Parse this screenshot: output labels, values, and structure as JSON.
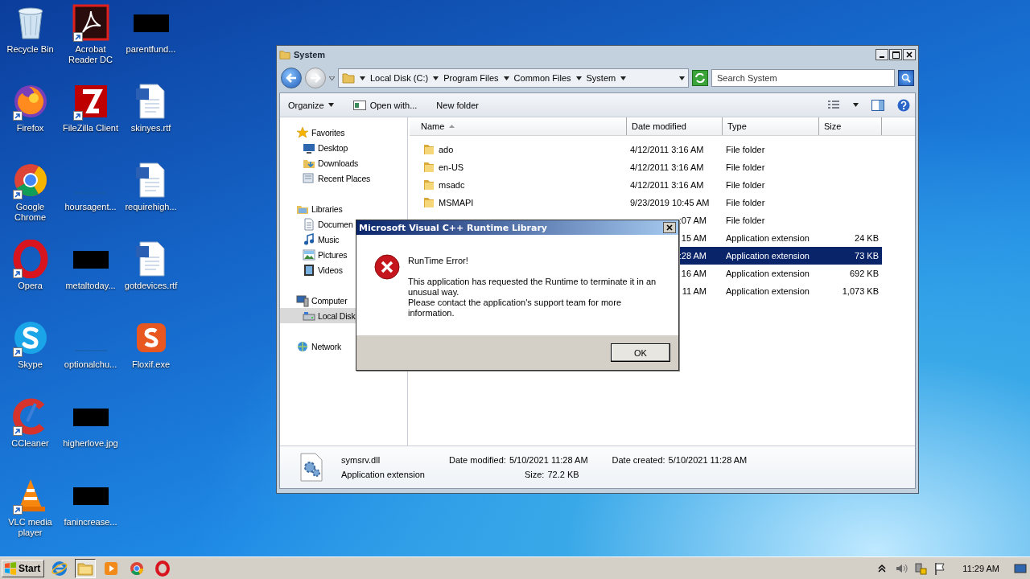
{
  "desktop_icons": [
    {
      "label": "Recycle Bin",
      "kind": "recycle",
      "shortcut": false
    },
    {
      "label": "Firefox",
      "kind": "firefox",
      "shortcut": true
    },
    {
      "label": "Google Chrome",
      "kind": "chrome",
      "shortcut": true
    },
    {
      "label": "Opera",
      "kind": "opera",
      "shortcut": true
    },
    {
      "label": "Skype",
      "kind": "skype",
      "shortcut": true
    },
    {
      "label": "CCleaner",
      "kind": "ccleaner",
      "shortcut": true
    },
    {
      "label": "VLC media player",
      "kind": "vlc",
      "shortcut": true
    },
    {
      "label": "Acrobat Reader DC",
      "kind": "acrobat",
      "shortcut": true
    },
    {
      "label": "FileZilla Client",
      "kind": "filezilla",
      "shortcut": true
    },
    {
      "label": "hoursagent...",
      "kind": "blank",
      "shortcut": false
    },
    {
      "label": "metaltoday...",
      "kind": "dark",
      "shortcut": false
    },
    {
      "label": "optionalchu...",
      "kind": "blank",
      "shortcut": false
    },
    {
      "label": "higherlove.jpg",
      "kind": "dark",
      "shortcut": false
    },
    {
      "label": "fanincrease...",
      "kind": "dark",
      "shortcut": false
    },
    {
      "label": "parentfund...",
      "kind": "dark",
      "shortcut": false
    },
    {
      "label": "skinyes.rtf",
      "kind": "word",
      "shortcut": false
    },
    {
      "label": "requirehigh...",
      "kind": "word",
      "shortcut": false
    },
    {
      "label": "gotdevices.rtf",
      "kind": "word",
      "shortcut": false
    },
    {
      "label": "Floxif.exe",
      "kind": "floxif",
      "shortcut": false
    }
  ],
  "explorer": {
    "title": "System",
    "breadcrumb": [
      "Local Disk (C:)",
      "Program Files",
      "Common Files",
      "System"
    ],
    "search": {
      "placeholder": "Search System"
    },
    "toolbar": {
      "organize": "Organize",
      "open_with": "Open with...",
      "new_folder": "New folder"
    },
    "nav": [
      {
        "label": "Favorites",
        "kind": "star",
        "selected": false,
        "children": [
          {
            "label": "Desktop",
            "kind": "desktop",
            "selected": false
          },
          {
            "label": "Downloads",
            "kind": "downloads",
            "selected": false
          },
          {
            "label": "Recent Places",
            "kind": "recent",
            "selected": false
          }
        ]
      },
      {
        "label": "Libraries",
        "kind": "libraries",
        "selected": false,
        "children": [
          {
            "label": "Documen",
            "kind": "documents",
            "selected": false
          },
          {
            "label": "Music",
            "kind": "music",
            "selected": false
          },
          {
            "label": "Pictures",
            "kind": "pictures",
            "selected": false
          },
          {
            "label": "Videos",
            "kind": "videos",
            "selected": false
          }
        ]
      },
      {
        "label": "Computer",
        "kind": "computer",
        "selected": false,
        "children": [
          {
            "label": "Local Disk",
            "kind": "disk",
            "selected": true
          }
        ]
      },
      {
        "label": "Network",
        "kind": "network",
        "selected": false
      }
    ],
    "columns": [
      {
        "label": "Name",
        "sorted": true
      },
      {
        "label": "Date modified",
        "sorted": false
      },
      {
        "label": "Type",
        "sorted": false
      },
      {
        "label": "Size",
        "sorted": false
      }
    ],
    "files": [
      {
        "kind": "folder",
        "name": "ado",
        "date": "4/12/2011 3:16 AM",
        "type": "File folder",
        "selected": false
      },
      {
        "kind": "folder",
        "name": "en-US",
        "date": "4/12/2011 3:16 AM",
        "type": "File folder",
        "selected": false
      },
      {
        "kind": "folder",
        "name": "msadc",
        "date": "4/12/2011 3:16 AM",
        "type": "File folder",
        "selected": false
      },
      {
        "kind": "folder",
        "name": "MSMAPI",
        "date": "9/23/2019 10:45 AM",
        "type": "File folder",
        "selected": false
      },
      {
        "kind": "hidden",
        "date": ":07 AM",
        "type": "File folder",
        "selected": false
      },
      {
        "kind": "hidden",
        "date": "15 AM",
        "type": "Application extension",
        "size": "24 KB",
        "selected": false
      },
      {
        "kind": "hidden",
        "date": ":28 AM",
        "type": "Application extension",
        "size": "73 KB",
        "selected": true
      },
      {
        "kind": "hidden",
        "date": "16 AM",
        "type": "Application extension",
        "size": "692 KB",
        "selected": false
      },
      {
        "kind": "hidden",
        "date": "11 AM",
        "type": "Application extension",
        "size": "1,073 KB",
        "selected": false
      }
    ],
    "details": {
      "name": "symsrv.dll",
      "type": "Application extension",
      "modified_label": "Date modified:",
      "modified": "5/10/2021 11:28 AM",
      "created_label": "Date created:",
      "created": "5/10/2021 11:28 AM",
      "size_label": "Size:",
      "size": "72.2 KB"
    }
  },
  "dialog": {
    "title": "Microsoft Visual C++ Runtime Library",
    "heading": "RunTime Error!",
    "message": [
      "This application has requested the Runtime to terminate it in an unusual way.",
      "Please contact the application's support team for more information."
    ],
    "button": "OK"
  },
  "taskbar": {
    "start": "Start",
    "apps": [
      {
        "kind": "ie",
        "active": false
      },
      {
        "kind": "folder",
        "active": true
      },
      {
        "kind": "media",
        "active": false
      },
      {
        "kind": "chrome",
        "active": false
      },
      {
        "kind": "opera",
        "active": false
      }
    ],
    "clock": "11:29 AM"
  }
}
